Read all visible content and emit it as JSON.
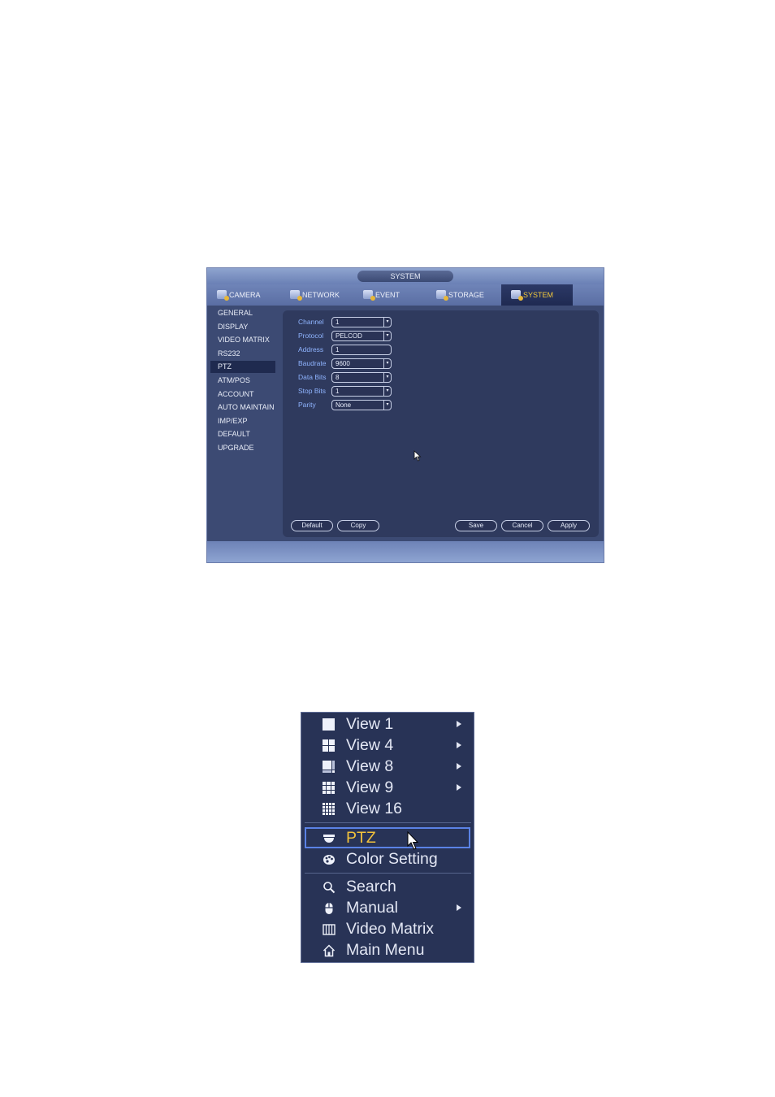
{
  "system_window": {
    "title": "SYSTEM",
    "tabs": [
      {
        "label": "CAMERA",
        "icon": "camera-icon"
      },
      {
        "label": "NETWORK",
        "icon": "network-icon"
      },
      {
        "label": "EVENT",
        "icon": "event-icon"
      },
      {
        "label": "STORAGE",
        "icon": "storage-icon"
      },
      {
        "label": "SYSTEM",
        "icon": "system-icon",
        "active": true
      }
    ],
    "sidebar": [
      {
        "label": "GENERAL"
      },
      {
        "label": "DISPLAY"
      },
      {
        "label": "VIDEO MATRIX"
      },
      {
        "label": "RS232"
      },
      {
        "label": "PTZ",
        "active": true
      },
      {
        "label": "ATM/POS"
      },
      {
        "label": "ACCOUNT"
      },
      {
        "label": "AUTO MAINTAIN"
      },
      {
        "label": "IMP/EXP"
      },
      {
        "label": "DEFAULT"
      },
      {
        "label": "UPGRADE"
      }
    ],
    "fields": [
      {
        "label": "Channel",
        "value": "1",
        "type": "dropdown"
      },
      {
        "label": "Protocol",
        "value": "PELCOD",
        "type": "dropdown"
      },
      {
        "label": "Address",
        "value": "1",
        "type": "input"
      },
      {
        "label": "Baudrate",
        "value": "9600",
        "type": "dropdown"
      },
      {
        "label": "Data Bits",
        "value": "8",
        "type": "dropdown"
      },
      {
        "label": "Stop Bits",
        "value": "1",
        "type": "dropdown"
      },
      {
        "label": "Parity",
        "value": "None",
        "type": "dropdown"
      }
    ],
    "buttons": {
      "default": "Default",
      "copy": "Copy",
      "save": "Save",
      "cancel": "Cancel",
      "apply": "Apply"
    },
    "colors": {
      "window_bg": "#3c4a73",
      "content_bg": "#2f3a5e",
      "label_blue": "#8fb4ff",
      "active_tab_text": "#f3c93b"
    }
  },
  "context_menu": {
    "items": [
      {
        "label": "View 1",
        "icon": "view-1-icon",
        "submenu": true
      },
      {
        "label": "View 4",
        "icon": "view-4-icon",
        "submenu": true
      },
      {
        "label": "View 8",
        "icon": "view-8-icon",
        "submenu": true
      },
      {
        "label": "View 9",
        "icon": "view-9-icon",
        "submenu": true
      },
      {
        "label": "View 16",
        "icon": "view-16-icon",
        "submenu": false
      },
      {
        "label": "PTZ",
        "icon": "ptz-dome-icon",
        "submenu": false,
        "highlighted": true
      },
      {
        "label": "Color Setting",
        "icon": "color-palette-icon",
        "submenu": false
      },
      {
        "label": "Search",
        "icon": "search-icon",
        "submenu": false
      },
      {
        "label": "Manual",
        "icon": "mouse-icon",
        "submenu": true
      },
      {
        "label": "Video Matrix",
        "icon": "video-matrix-icon",
        "submenu": false
      },
      {
        "label": "Main Menu",
        "icon": "home-icon",
        "submenu": false
      }
    ],
    "colors": {
      "bg": "#283356",
      "highlight_border": "#5a82e6",
      "highlight_text": "#f2c23c"
    }
  }
}
